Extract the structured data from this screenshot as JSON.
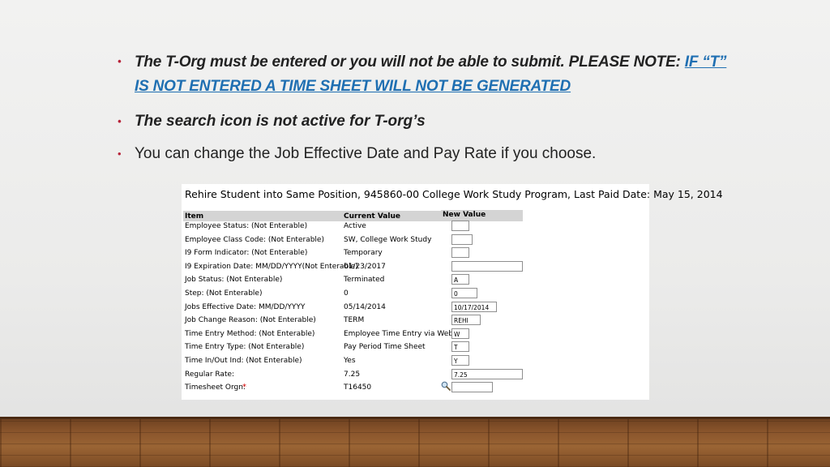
{
  "bullets": [
    {
      "text": "The T-Org must be entered or you will not be able to submit. PLEASE NOTE: ",
      "link_line1": "IF “T”",
      "link_line2": "IS NOT ENTERED A TIME SHEET WILL NOT BE GENERATED"
    },
    {
      "text": "The search icon is not active for T-org’s"
    },
    {
      "text": "You can change the Job Effective Date and Pay Rate if you choose."
    }
  ],
  "form": {
    "title": "Rehire Student into Same Position, 945860-00 College Work Study Program, Last Paid Date: May 15, 2014",
    "headers": {
      "item": "Item",
      "current": "Current Value",
      "new": "New Value"
    },
    "rows": [
      {
        "item": "Employee Status: (Not Enterable)",
        "current": "Active",
        "new": ""
      },
      {
        "item": "Employee Class Code: (Not Enterable)",
        "current": "SW, College Work Study",
        "new": ""
      },
      {
        "item": "I9 Form Indicator: (Not Enterable)",
        "current": "Temporary",
        "new": ""
      },
      {
        "item": "I9 Expiration Date: MM/DD/YYYY(Not Enterable)",
        "current": "01/23/2017",
        "new": ""
      },
      {
        "item": "Job Status: (Not Enterable)",
        "current": "Terminated",
        "new": "A"
      },
      {
        "item": "Step: (Not Enterable)",
        "current": "0",
        "new": "0"
      },
      {
        "item": "Jobs Effective Date: MM/DD/YYYY",
        "current": "05/14/2014",
        "new": "10/17/2014"
      },
      {
        "item": "Job Change Reason: (Not Enterable)",
        "current": "TERM",
        "new": "REHI"
      },
      {
        "item": "Time Entry Method: (Not Enterable)",
        "current": "Employee Time Entry via Web",
        "new": "W"
      },
      {
        "item": "Time Entry Type: (Not Enterable)",
        "current": "Pay Period Time Sheet",
        "new": "T"
      },
      {
        "item": "Time In/Out Ind: (Not Enterable)",
        "current": "Yes",
        "new": "Y"
      },
      {
        "item": "Regular Rate:",
        "current": "7.25",
        "new": "7.25"
      },
      {
        "item": "Timesheet Orgn:",
        "current": "T16450",
        "new": "",
        "required_mark": "*"
      }
    ]
  },
  "colors": {
    "bullet": "#b7243a",
    "link": "#1f6fb2",
    "required": "#dd1111"
  },
  "icons": {
    "search": "magnifier-icon"
  }
}
